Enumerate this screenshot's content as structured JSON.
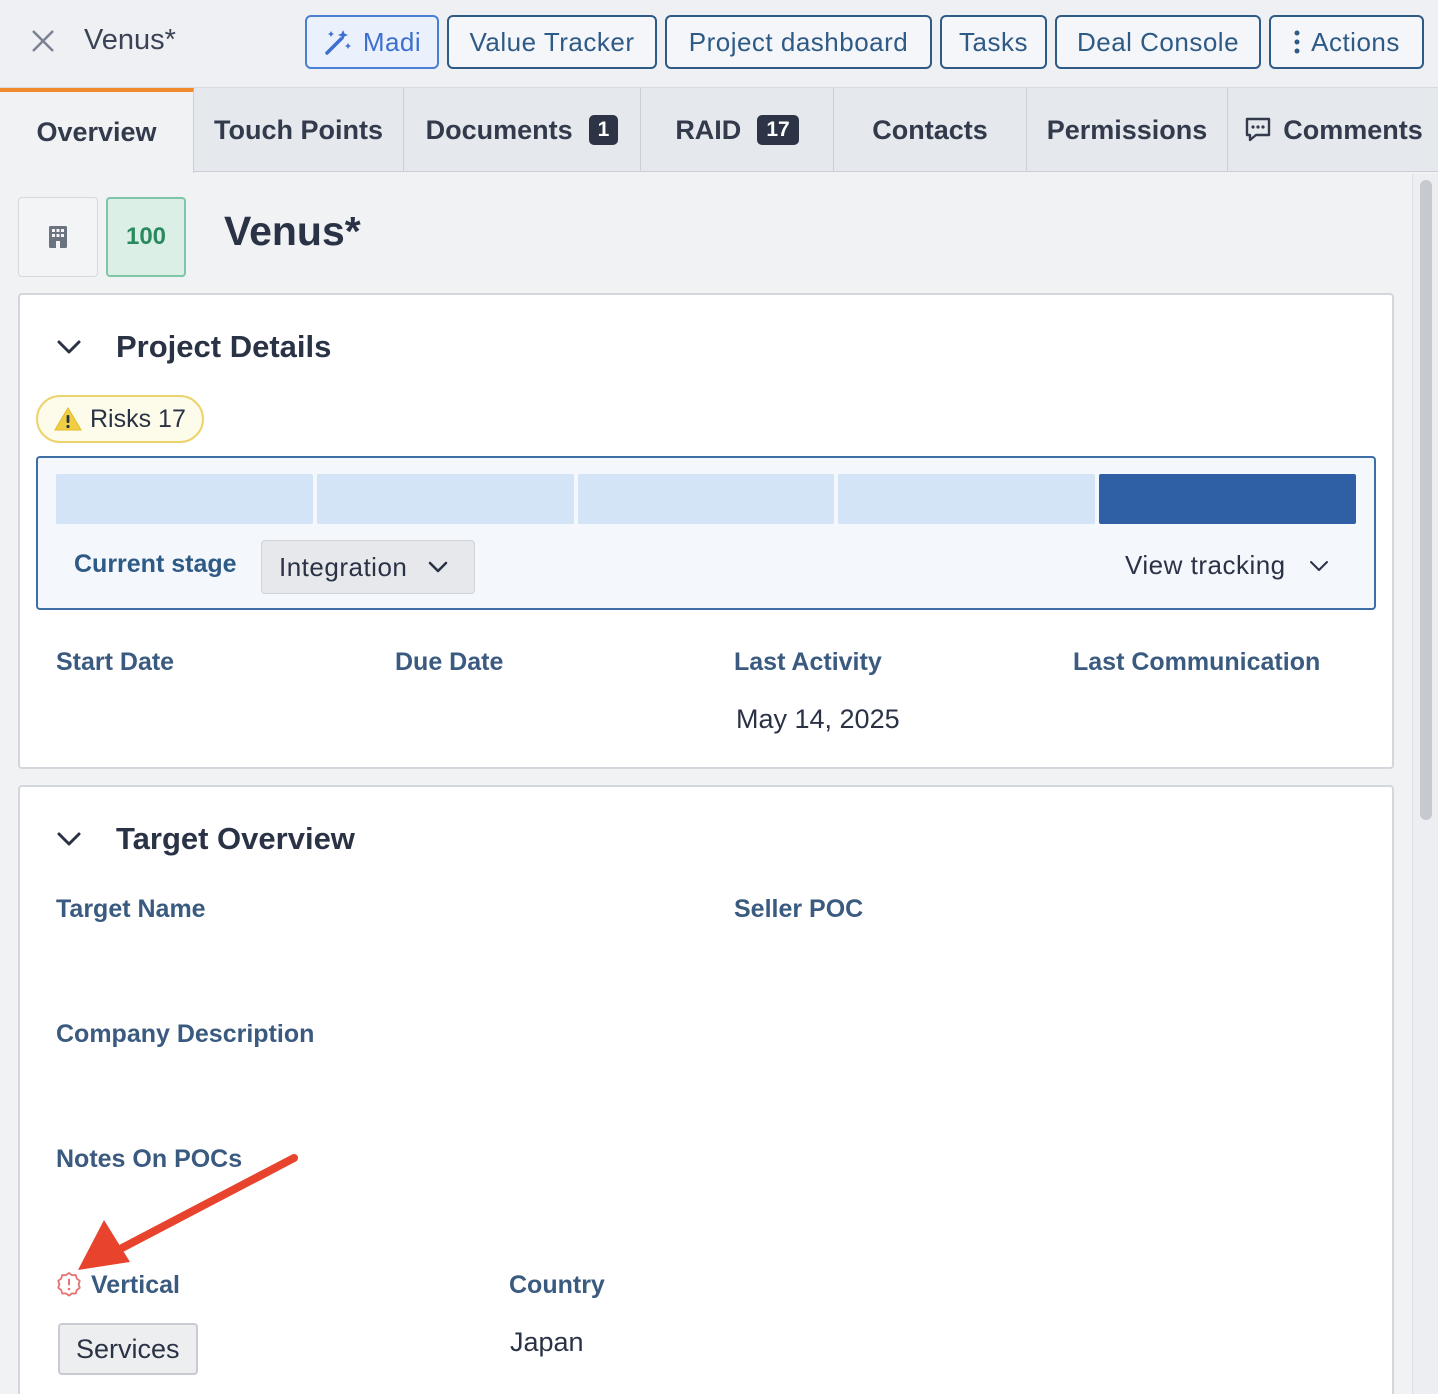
{
  "window": {
    "title": "Venus*"
  },
  "toolbar": {
    "madi": "Madi",
    "value_tracker": "Value Tracker",
    "project_dashboard": "Project dashboard",
    "tasks": "Tasks",
    "deal_console": "Deal Console",
    "actions": "Actions"
  },
  "tabs": [
    {
      "label": "Overview",
      "active": true
    },
    {
      "label": "Touch Points"
    },
    {
      "label": "Documents",
      "badge": "1"
    },
    {
      "label": "RAID",
      "badge": "17"
    },
    {
      "label": "Contacts"
    },
    {
      "label": "Permissions"
    },
    {
      "label": "Comments"
    }
  ],
  "header": {
    "score": "100",
    "title": "Venus*"
  },
  "project_details": {
    "title": "Project Details",
    "risks_label": "Risks 17",
    "stages_completed_fraction": 1.0,
    "current_stage_label": "Current stage",
    "current_stage_value": "Integration",
    "view_tracking": "View tracking",
    "fields": [
      {
        "label": "Start Date",
        "value": ""
      },
      {
        "label": "Due Date",
        "value": ""
      },
      {
        "label": "Last Activity",
        "value": "May 14, 2025"
      },
      {
        "label": "Last Communication",
        "value": ""
      }
    ]
  },
  "target_overview": {
    "title": "Target Overview",
    "target_name_label": "Target Name",
    "seller_poc_label": "Seller POC",
    "company_description_label": "Company Description",
    "notes_on_pocs_label": "Notes On POCs",
    "vertical_label": "Vertical",
    "vertical_value": "Services",
    "country_label": "Country",
    "country_value": "Japan"
  },
  "colors": {
    "accent": "#2e5a86",
    "active_tab": "#f08a2c",
    "score_green": "#2a8a5f",
    "stage_done": "#2f60a6",
    "annotation_arrow": "#e8432d"
  }
}
